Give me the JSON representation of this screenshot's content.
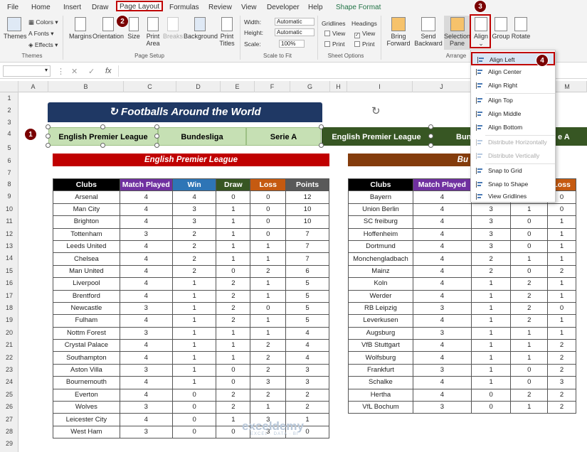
{
  "ribbon": {
    "tabs": [
      "File",
      "Home",
      "Insert",
      "Draw",
      "Page Layout",
      "Formulas",
      "Review",
      "View",
      "Developer",
      "Help",
      "Shape Format"
    ],
    "active_tab": "Page Layout",
    "themes": {
      "themes": "Themes",
      "colors": "Colors",
      "fonts": "Fonts",
      "effects": "Effects",
      "group": "Themes"
    },
    "page_setup": {
      "margins": "Margins",
      "orientation": "Orientation",
      "size": "Size",
      "print_area": "Print Area",
      "breaks": "Breaks",
      "background": "Background",
      "print_titles": "Print Titles",
      "group": "Page Setup"
    },
    "scale": {
      "width_label": "Width:",
      "width_value": "Automatic",
      "height_label": "Height:",
      "height_value": "Automatic",
      "scale_label": "Scale:",
      "scale_value": "100%",
      "group": "Scale to Fit"
    },
    "sheet_options": {
      "gridlines": "Gridlines",
      "headings": "Headings",
      "view": "View",
      "print": "Print",
      "group": "Sheet Options"
    },
    "arrange": {
      "bring_forward": "Bring Forward",
      "send_backward": "Send Backward",
      "selection_pane": "Selection Pane",
      "align": "Align",
      "group_btn": "Group",
      "rotate": "Rotate",
      "group": "Arrange"
    }
  },
  "formula_bar": {
    "fx": "fx"
  },
  "columns": [
    "A",
    "B",
    "C",
    "D",
    "E",
    "F",
    "G",
    "H",
    "I",
    "J",
    "K",
    "L",
    "M"
  ],
  "rows": [
    "1",
    "2",
    "3",
    "4",
    "5",
    "6",
    "7",
    "8",
    "9",
    "10",
    "11",
    "12",
    "13",
    "14",
    "15",
    "16",
    "17",
    "18",
    "19",
    "20",
    "21",
    "22",
    "23",
    "24",
    "25",
    "26",
    "27",
    "28",
    "29"
  ],
  "sheet": {
    "title": "Footballs Around the World",
    "buttons": [
      "English Premier League",
      "Bundesliga",
      "Serie A",
      "English Premier League",
      "Bun",
      "e A"
    ],
    "epl_header": "English Premier League",
    "bl_header": "Bu",
    "epl_columns": [
      "Clubs",
      "Match Played",
      "Win",
      "Draw",
      "Loss",
      "Points"
    ],
    "epl_rows": [
      [
        "Arsenal",
        "4",
        "4",
        "0",
        "0",
        "12"
      ],
      [
        "Man City",
        "4",
        "3",
        "1",
        "0",
        "10"
      ],
      [
        "Brighton",
        "4",
        "3",
        "1",
        "0",
        "10"
      ],
      [
        "Tottenham",
        "3",
        "2",
        "1",
        "0",
        "7"
      ],
      [
        "Leeds United",
        "4",
        "2",
        "1",
        "1",
        "7"
      ],
      [
        "Chelsea",
        "4",
        "2",
        "1",
        "1",
        "7"
      ],
      [
        "Man United",
        "4",
        "2",
        "0",
        "2",
        "6"
      ],
      [
        "Liverpool",
        "4",
        "1",
        "2",
        "1",
        "5"
      ],
      [
        "Brentford",
        "4",
        "1",
        "2",
        "1",
        "5"
      ],
      [
        "Newcastle",
        "3",
        "1",
        "2",
        "0",
        "5"
      ],
      [
        "Fulham",
        "4",
        "1",
        "2",
        "1",
        "5"
      ],
      [
        "Nottm Forest",
        "3",
        "1",
        "1",
        "1",
        "4"
      ],
      [
        "Crystal Palace",
        "4",
        "1",
        "1",
        "2",
        "4"
      ],
      [
        "Southampton",
        "4",
        "1",
        "1",
        "2",
        "4"
      ],
      [
        "Aston Villa",
        "3",
        "1",
        "0",
        "2",
        "3"
      ],
      [
        "Bournemouth",
        "4",
        "1",
        "0",
        "3",
        "3"
      ],
      [
        "Everton",
        "4",
        "0",
        "2",
        "2",
        "2"
      ],
      [
        "Wolves",
        "3",
        "0",
        "2",
        "1",
        "2"
      ],
      [
        "Leicester City",
        "4",
        "0",
        "1",
        "3",
        "1"
      ],
      [
        "West Ham",
        "3",
        "0",
        "0",
        "3",
        "0"
      ]
    ],
    "bl_columns": [
      "Clubs",
      "Match Played",
      "",
      "",
      "Loss"
    ],
    "bl_rows": [
      [
        "Bayern",
        "4",
        "",
        "",
        "0"
      ],
      [
        "Union Berlin",
        "4",
        "3",
        "1",
        "0"
      ],
      [
        "SC freiburg",
        "4",
        "3",
        "0",
        "1"
      ],
      [
        "Hoffenheim",
        "4",
        "3",
        "0",
        "1"
      ],
      [
        "Dortmund",
        "4",
        "3",
        "0",
        "1"
      ],
      [
        "Monchengladbach",
        "4",
        "2",
        "1",
        "1"
      ],
      [
        "Mainz",
        "4",
        "2",
        "0",
        "2"
      ],
      [
        "Koln",
        "4",
        "1",
        "2",
        "1"
      ],
      [
        "Werder",
        "4",
        "1",
        "2",
        "1"
      ],
      [
        "RB Leipzig",
        "3",
        "1",
        "2",
        "0"
      ],
      [
        "Leverkusen",
        "4",
        "1",
        "2",
        "1"
      ],
      [
        "Augsburg",
        "3",
        "1",
        "1",
        "1"
      ],
      [
        "VfB Stuttgart",
        "4",
        "1",
        "1",
        "2"
      ],
      [
        "Wolfsburg",
        "4",
        "1",
        "1",
        "2"
      ],
      [
        "Frankfurt",
        "3",
        "1",
        "0",
        "2"
      ],
      [
        "Schalke",
        "4",
        "1",
        "0",
        "3"
      ],
      [
        "Hertha",
        "4",
        "0",
        "2",
        "2"
      ],
      [
        "VfL Bochum",
        "3",
        "0",
        "1",
        "2"
      ]
    ]
  },
  "align_menu": {
    "items": [
      "Align Left",
      "Align Center",
      "Align Right",
      "Align Top",
      "Align Middle",
      "Align Bottom",
      "Distribute Horizontally",
      "Distribute Vertically",
      "Snap to Grid",
      "Snap to Shape",
      "View Gridlines"
    ]
  },
  "badges": [
    "1",
    "2",
    "3",
    "4"
  ],
  "watermark": {
    "name": "exceldemy",
    "tag": "EXCEL · DATA · BI"
  },
  "colors": {
    "title_bg": "#1f3864",
    "epl_header": "#c00000",
    "bl_header": "#843c0c",
    "match_played": "#7030a0",
    "win": "#2e75b6",
    "draw": "#375623",
    "loss": "#c55a11",
    "points": "#595959",
    "clubs": "#000000"
  }
}
